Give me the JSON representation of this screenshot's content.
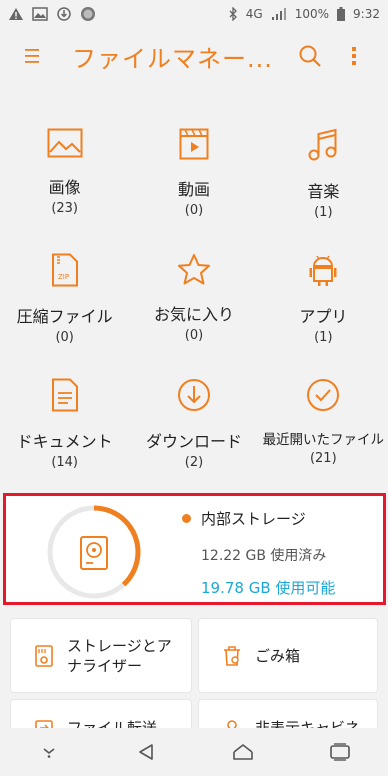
{
  "status_bar": {
    "network": "4G",
    "battery": "100%",
    "time": "9:32"
  },
  "app_bar": {
    "title": "ファイルマネー..."
  },
  "categories": [
    {
      "label": "画像",
      "count": "(23)",
      "icon": "image-icon"
    },
    {
      "label": "動画",
      "count": "(0)",
      "icon": "video-icon"
    },
    {
      "label": "音楽",
      "count": "(1)",
      "icon": "music-icon"
    },
    {
      "label": "圧縮ファイル",
      "count": "(0)",
      "icon": "zip-icon"
    },
    {
      "label": "お気に入り",
      "count": "(0)",
      "icon": "star-icon"
    },
    {
      "label": "アプリ",
      "count": "(1)",
      "icon": "android-icon"
    },
    {
      "label": "ドキュメント",
      "count": "(14)",
      "icon": "document-icon"
    },
    {
      "label": "ダウンロード",
      "count": "(2)",
      "icon": "download-icon"
    },
    {
      "label": "最近開いたファイル",
      "count": "(21)",
      "icon": "recent-check-icon"
    }
  ],
  "storage": {
    "name": "内部ストレージ",
    "used": "12.22 GB 使用済み",
    "available": "19.78 GB 使用可能",
    "used_fraction": 0.382
  },
  "tools": [
    {
      "label": "ストレージとア\nナライザー",
      "icon": "storage-analyzer-icon"
    },
    {
      "label": "ごみ箱",
      "icon": "trash-icon"
    },
    {
      "label": "ファイル転送",
      "icon": "file-transfer-icon"
    },
    {
      "label": "非表示キャビネ",
      "icon": "hidden-cabinet-icon"
    }
  ],
  "colors": {
    "accent": "#f07f1f",
    "available_text": "#1ba8d6",
    "highlight_border": "#e5182c"
  }
}
